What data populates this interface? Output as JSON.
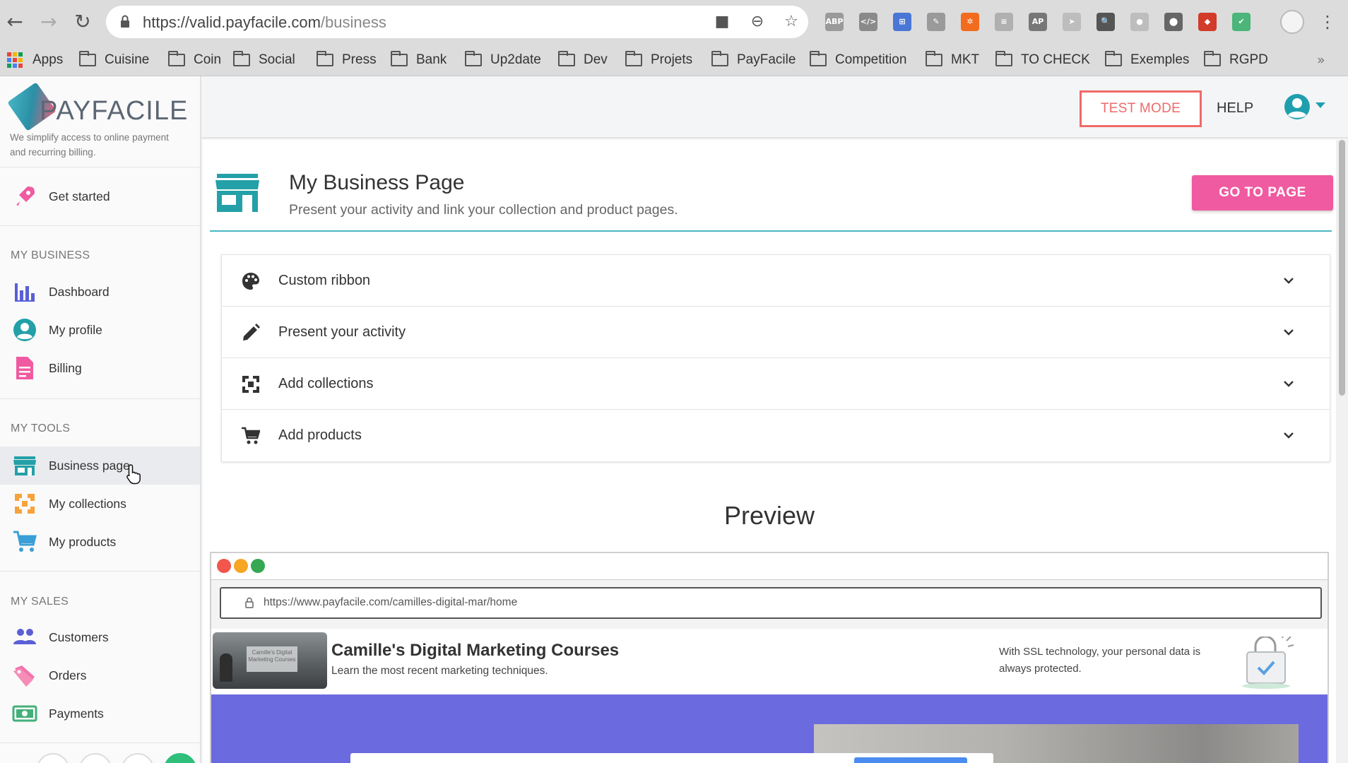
{
  "browser": {
    "url_host": "https://valid.payfacile.com",
    "url_path": "/business",
    "bookmarks": [
      "Apps",
      "Cuisine",
      "Coin",
      "Social",
      "Press",
      "Bank",
      "Up2date",
      "Dev",
      "Projets",
      "PayFacile",
      "Competition",
      "MKT",
      "TO CHECK",
      "Exemples",
      "RGPD"
    ],
    "extensions": [
      {
        "name": "abp-icon",
        "label": "ABP",
        "color": "#9a9a9a"
      },
      {
        "name": "code-icon",
        "label": "</>",
        "color": "#8a8a8a"
      },
      {
        "name": "extension-blue-icon",
        "label": "⊞",
        "color": "#4a76d6"
      },
      {
        "name": "extension-edit-icon",
        "label": "✎",
        "color": "#9a9a9a"
      },
      {
        "name": "extension-orange-icon",
        "label": "✲",
        "color": "#f26b1f"
      },
      {
        "name": "extension-gray-icon",
        "label": "≡",
        "color": "#b0b0b0"
      },
      {
        "name": "extension-ap-icon",
        "label": "AP",
        "color": "#777777"
      },
      {
        "name": "extension-arrow-icon",
        "label": "➤",
        "color": "#bdbdbd"
      },
      {
        "name": "extension-magnifier-icon",
        "label": "🔍",
        "color": "#555555"
      },
      {
        "name": "extension-toggle-icon",
        "label": "●",
        "color": "#bdbdbd"
      },
      {
        "name": "extension-pin-icon",
        "label": "⬤",
        "color": "#666666"
      },
      {
        "name": "extension-red-icon",
        "label": "◆",
        "color": "#d23a2a"
      },
      {
        "name": "extension-check-icon",
        "label": "✔",
        "color": "#4bb57a"
      }
    ]
  },
  "brand": {
    "logo_text": "PAYFACILE",
    "tagline": "We simplify access to online payment and recurring billing."
  },
  "sidebar": {
    "get_started": "Get started",
    "sections": {
      "business": "MY BUSINESS",
      "tools": "MY TOOLS",
      "sales": "MY SALES"
    },
    "business_items": [
      {
        "label": "Dashboard",
        "icon": "bar-chart-icon"
      },
      {
        "label": "My profile",
        "icon": "user-circle-icon"
      },
      {
        "label": "Billing",
        "icon": "document-icon"
      }
    ],
    "tools_items": [
      {
        "label": "Business page",
        "icon": "store-icon",
        "active": true
      },
      {
        "label": "My collections",
        "icon": "collections-icon"
      },
      {
        "label": "My products",
        "icon": "cart-icon"
      }
    ],
    "sales_items": [
      {
        "label": "Customers",
        "icon": "people-icon"
      },
      {
        "label": "Orders",
        "icon": "tag-icon"
      },
      {
        "label": "Payments",
        "icon": "money-icon"
      }
    ]
  },
  "topbar": {
    "test_mode": "TEST MODE",
    "help": "HELP"
  },
  "page": {
    "title": "My Business Page",
    "subtitle": "Present your activity and link your collection and product pages.",
    "go_button": "GO TO PAGE",
    "sections": [
      {
        "label": "Custom ribbon",
        "icon": "palette-icon"
      },
      {
        "label": "Present your activity",
        "icon": "pencil-icon"
      },
      {
        "label": "Add collections",
        "icon": "collections-icon"
      },
      {
        "label": "Add products",
        "icon": "cart-icon"
      }
    ],
    "preview_title": "Preview"
  },
  "preview": {
    "url": "https://www.payfacile.com/camilles-digital-mar/home",
    "site_title": "Camille's Digital Marketing Courses",
    "site_subtitle": "Learn the most recent marketing techniques.",
    "thumb_text": "Camille's Digital Marketing Courses",
    "ssl_text": "With SSL technology, your personal data is always protected.",
    "hero_color": "#6c6adf"
  },
  "colors": {
    "accent_teal": "#2b9fb0",
    "accent_pink": "#f05aa0",
    "test_mode_red": "#ef6a6a"
  }
}
